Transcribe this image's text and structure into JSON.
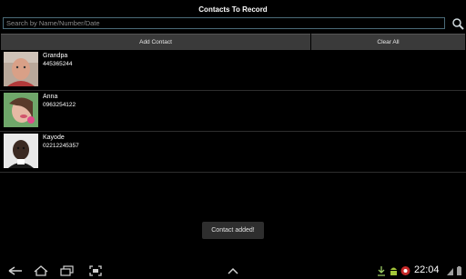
{
  "app": {
    "title": "Contacts To Record"
  },
  "search": {
    "placeholder": "Search by Name/Number/Date",
    "value": ""
  },
  "buttons": {
    "add_contact": "Add Contact",
    "clear_all": "Clear All"
  },
  "contacts": [
    {
      "name": "Grandpa",
      "number": "445365244"
    },
    {
      "name": "Anna",
      "number": "0963254122"
    },
    {
      "name": "Kayode",
      "number": "02212245357"
    }
  ],
  "toast": "Contact added!",
  "status_bar": {
    "time": "22:04",
    "icons": [
      "back-icon",
      "home-icon",
      "recent-apps-icon",
      "screenshot-icon",
      "up-chevron-icon",
      "download-icon",
      "android-icon",
      "record-icon",
      "wifi-icon",
      "signal-icon",
      "battery-icon"
    ]
  },
  "colors": {
    "background": "#000000",
    "button": "#3a3a3a",
    "search_border": "#4a6a78"
  }
}
